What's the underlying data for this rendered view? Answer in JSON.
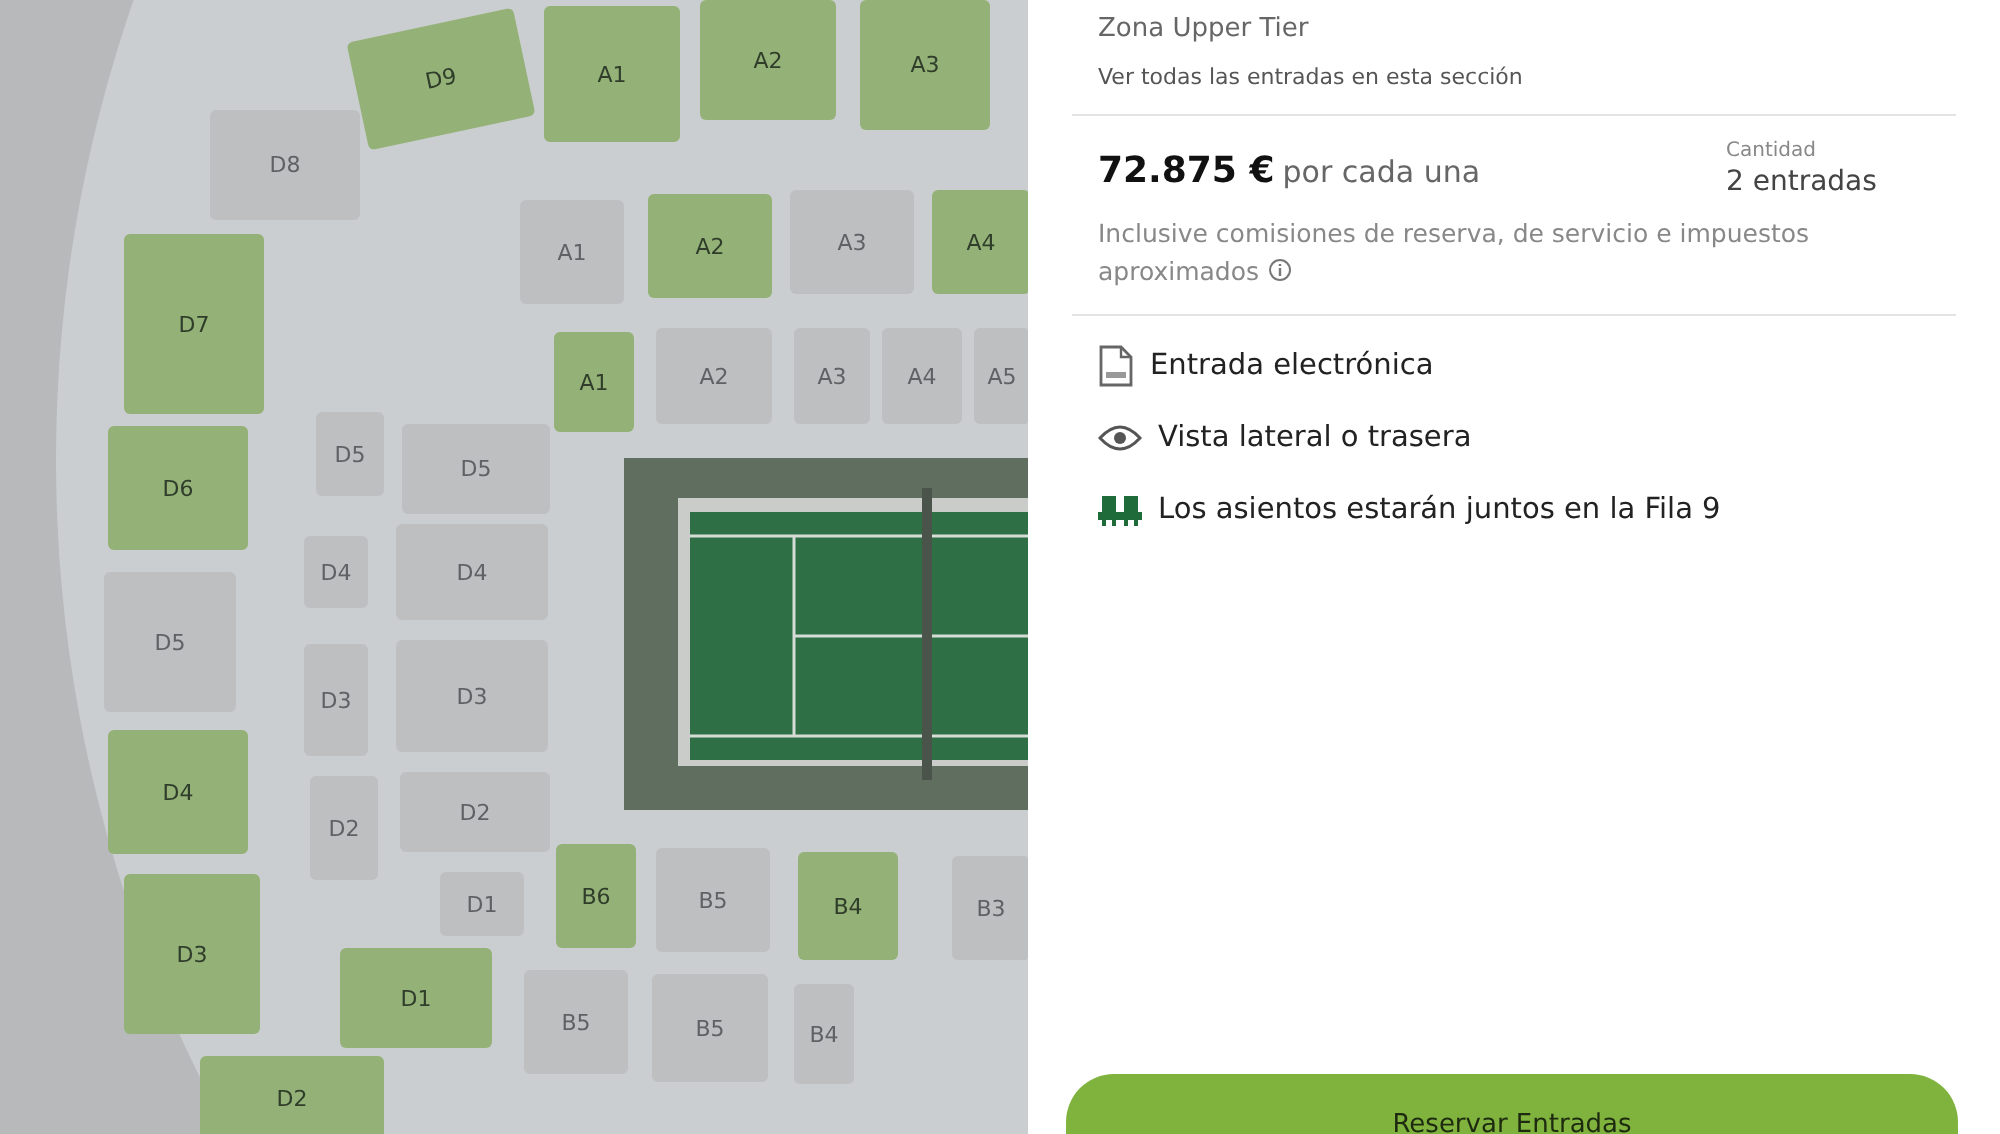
{
  "seat_map": {
    "sections": [
      {
        "label": "D8",
        "available": false
      },
      {
        "label": "D9",
        "available": true
      },
      {
        "label": "A1",
        "available": true
      },
      {
        "label": "A2",
        "available": true
      },
      {
        "label": "A3",
        "available": true
      },
      {
        "label": "D7",
        "available": true
      },
      {
        "label": "A1",
        "available": false
      },
      {
        "label": "A2",
        "available": true
      },
      {
        "label": "A3",
        "available": false
      },
      {
        "label": "A4",
        "available": true
      },
      {
        "label": "A1",
        "available": true
      },
      {
        "label": "A2",
        "available": false
      },
      {
        "label": "A3",
        "available": false
      },
      {
        "label": "A4",
        "available": false
      },
      {
        "label": "A5",
        "available": false
      },
      {
        "label": "D6",
        "available": true
      },
      {
        "label": "D5",
        "available": false
      },
      {
        "label": "D5",
        "available": false
      },
      {
        "label": "D4",
        "available": false
      },
      {
        "label": "D4",
        "available": false
      },
      {
        "label": "D5",
        "available": false
      },
      {
        "label": "D3",
        "available": false
      },
      {
        "label": "D3",
        "available": false
      },
      {
        "label": "D4",
        "available": true
      },
      {
        "label": "D2",
        "available": false
      },
      {
        "label": "D2",
        "available": false
      },
      {
        "label": "D1",
        "available": false
      },
      {
        "label": "D3",
        "available": true
      },
      {
        "label": "D1",
        "available": true
      },
      {
        "label": "D2",
        "available": true
      },
      {
        "label": "B6",
        "available": true
      },
      {
        "label": "B5",
        "available": false
      },
      {
        "label": "B4",
        "available": true
      },
      {
        "label": "B3",
        "available": false
      },
      {
        "label": "B5",
        "available": false
      },
      {
        "label": "B5",
        "available": false
      },
      {
        "label": "B4",
        "available": false
      }
    ]
  },
  "panel": {
    "zone": "Zona Upper Tier",
    "see_all_link": "Ver todas las entradas en esta sección",
    "price": "72.875 €",
    "price_suffix": "por cada una",
    "quantity_label": "Cantidad",
    "quantity": "2 entradas",
    "fees_note_lines": [
      "Inclusive comisiones de reserva, de servicio e impuestos",
      "aproximados"
    ],
    "features": [
      {
        "kind": "pdf",
        "text": "Entrada electrónica"
      },
      {
        "kind": "view",
        "text": "Vista lateral o trasera"
      },
      {
        "kind": "seats",
        "text": "Los asientos estarán juntos en la Fila 9"
      }
    ],
    "book_button": "Reservar Entradas"
  }
}
